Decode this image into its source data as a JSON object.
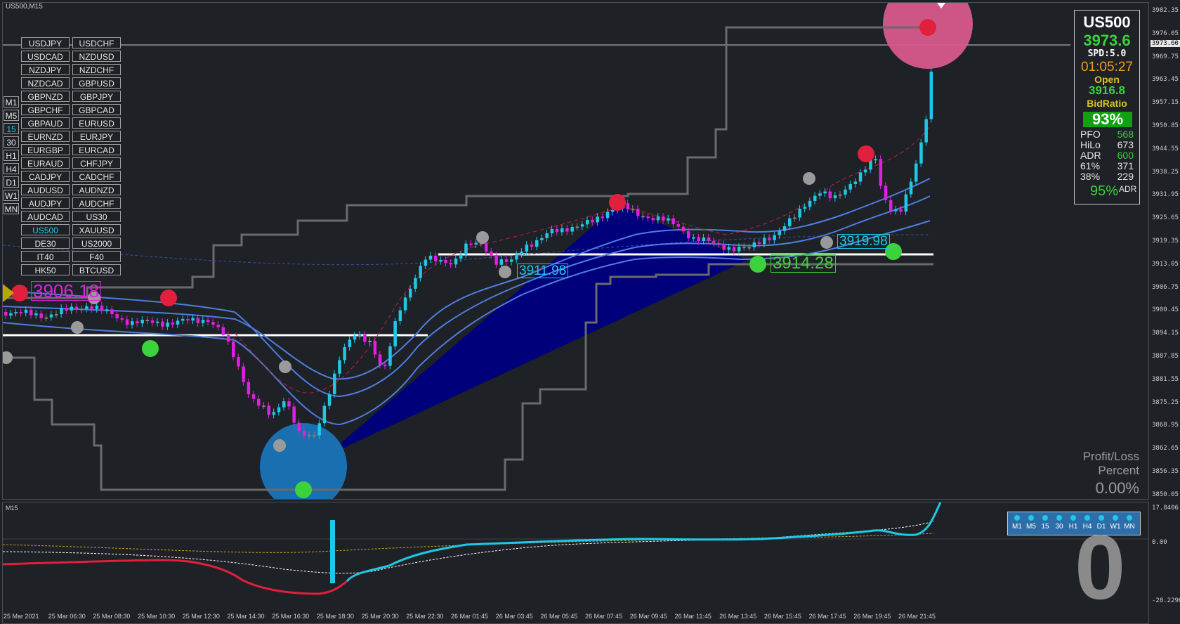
{
  "window": {
    "title": "US500,M15",
    "subwindow_title": "M15"
  },
  "price_axis": {
    "labels": [
      "3982.35",
      "3976.05",
      "3969.75",
      "3963.45",
      "3957.15",
      "3950.85",
      "3944.55",
      "3938.25",
      "3931.95",
      "3925.65",
      "3919.35",
      "3913.05",
      "3906.75",
      "3900.45",
      "3894.15",
      "3887.85",
      "3881.55",
      "3875.25",
      "3868.95",
      "3862.65",
      "3856.35",
      "3850.05"
    ],
    "current_price_tag": "3973.60",
    "osc_labels": [
      "17.8406",
      "0.00",
      "-28.2296"
    ]
  },
  "time_axis": {
    "labels": [
      "25 Mar 2021",
      "25 Mar 06:30",
      "25 Mar 08:30",
      "25 Mar 10:30",
      "25 Mar 12:30",
      "25 Mar 14:30",
      "25 Mar 16:30",
      "25 Mar 18:30",
      "25 Mar 20:30",
      "25 Mar 22:30",
      "26 Mar 01:45",
      "26 Mar 03:45",
      "26 Mar 05:45",
      "26 Mar 07:45",
      "26 Mar 09:45",
      "26 Mar 11:45",
      "26 Mar 13:45",
      "26 Mar 15:45",
      "26 Mar 17:45",
      "26 Mar 19:45",
      "26 Mar 21:45"
    ]
  },
  "symbols": [
    [
      "USDJPY",
      "USDCHF"
    ],
    [
      "USDCAD",
      "NZDUSD"
    ],
    [
      "NZDJPY",
      "NZDCHF"
    ],
    [
      "NZDCAD",
      "GBPUSD"
    ],
    [
      "GBPNZD",
      "GBPJPY"
    ],
    [
      "GBPCHF",
      "GBPCAD"
    ],
    [
      "GBPAUD",
      "EURUSD"
    ],
    [
      "EURNZD",
      "EURJPY"
    ],
    [
      "EURGBP",
      "EURCAD"
    ],
    [
      "EURAUD",
      "CHFJPY"
    ],
    [
      "CADJPY",
      "CADCHF"
    ],
    [
      "AUDUSD",
      "AUDNZD"
    ],
    [
      "AUDJPY",
      "AUDCHF"
    ],
    [
      "AUDCAD",
      "US30"
    ],
    [
      "US500",
      "XAUUSD"
    ],
    [
      "DE30",
      "US2000"
    ],
    [
      "IT40",
      "F40"
    ],
    [
      "HK50",
      "BTCUSD"
    ]
  ],
  "active_symbol": "US500",
  "timeframes": [
    "M1",
    "M5",
    "15",
    "30",
    "H1",
    "H4",
    "D1",
    "W1",
    "MN"
  ],
  "active_timeframe": "15",
  "info_panel": {
    "symbol": "US500",
    "price": "3973.6",
    "spread": "SPD:5.0",
    "timer": "01:05:27",
    "open_label": "Open",
    "open_value": "3916.8",
    "bid_ratio_label": "BidRatio",
    "bid_ratio_value": "93%",
    "rows": [
      {
        "label": "PFO",
        "value": "568",
        "color": "#3cd23c"
      },
      {
        "label": "HiLo",
        "value": "673",
        "color": "#e6e6e6"
      },
      {
        "label": "ADR",
        "value": "600",
        "color": "#3cd23c"
      },
      {
        "label": "61%",
        "value": "371",
        "color": "#e6e6e6"
      },
      {
        "label": "38%",
        "value": "229",
        "color": "#e6e6e6"
      }
    ],
    "adr_percent": "95%",
    "adr_suffix": "ADR"
  },
  "price_tags": {
    "left": "3906.18",
    "t1": "3911.98",
    "t2": "3914.28",
    "t3": "3919.98"
  },
  "profit_loss": {
    "label_line1": "Profit/Loss",
    "label_line2": "Percent",
    "value": "0.00%"
  },
  "tf_dots": [
    "M1",
    "M5",
    "15",
    "30",
    "H1",
    "H4",
    "D1",
    "W1",
    "MN"
  ],
  "big_number": "0",
  "colors": {
    "background": "#1e2126",
    "bull_candle": "#1ec8e6",
    "bear_candle": "#e020e0",
    "neutral_candle": "#808080",
    "channel": "#6a6a6a",
    "band": "#4f7de0",
    "fan": "#00007a",
    "support_line": "#ffffff",
    "buy_dot": "#3cd23c",
    "sell_dot": "#e0203c",
    "neutral_dot": "#9a9a9a",
    "highlight_high": "#d85a8c",
    "highlight_low": "#1a6fb0"
  }
}
